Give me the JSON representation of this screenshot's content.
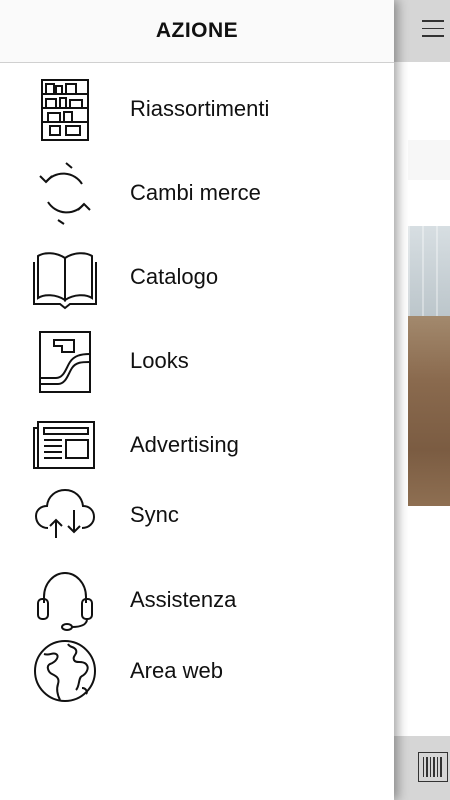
{
  "drawer": {
    "title": "AZIONE",
    "items": [
      {
        "label": "Riassortimenti",
        "icon": "shelves-icon"
      },
      {
        "label": "Cambi merce",
        "icon": "sync-arrows-icon"
      },
      {
        "label": "Catalogo",
        "icon": "open-book-icon"
      },
      {
        "label": "Looks",
        "icon": "looks-icon"
      },
      {
        "label": "Advertising",
        "icon": "newspaper-icon"
      },
      {
        "label": "Sync",
        "icon": "cloud-sync-icon"
      },
      {
        "label": "Assistenza",
        "icon": "headset-icon"
      },
      {
        "label": "Area web",
        "icon": "globe-icon"
      }
    ]
  },
  "background_app": {
    "menu_icon": "hamburger-icon",
    "footer_icon": "barcode-icon"
  },
  "colors": {
    "text": "#111111",
    "header_gray": "#d6d6d6"
  }
}
